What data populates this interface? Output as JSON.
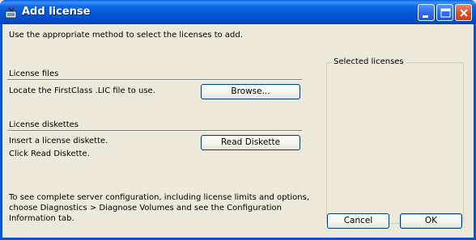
{
  "window": {
    "title": "Add license",
    "app_icon": "firstclass-app-icon",
    "controls": {
      "minimize": "minimize-icon",
      "maximize": "maximize-icon",
      "close": "close-icon"
    }
  },
  "intro": "Use the appropriate method to select the licenses to add.",
  "license_files": {
    "header": "License files",
    "description": "Locate the FirstClass .LIC file to use.",
    "browse_label": "Browse..."
  },
  "license_diskettes": {
    "header": "License diskettes",
    "line1": "Insert a license diskette.",
    "line2": "Click Read Diskette.",
    "read_label": "Read Diskette"
  },
  "note": {
    "line1": "To see complete server configuration, including license limits and options,",
    "line2": "choose Diagnostics > Diagnose Volumes and see the Configuration",
    "line3": "Information tab."
  },
  "selected_licenses": {
    "label": "Selected licenses"
  },
  "footer": {
    "cancel_label": "Cancel",
    "ok_label": "OK"
  },
  "colors": {
    "titlebar": "#0355d8",
    "dialog_bg": "#ece9d8",
    "button_border": "#003c74",
    "close_button": "#d9532c"
  }
}
